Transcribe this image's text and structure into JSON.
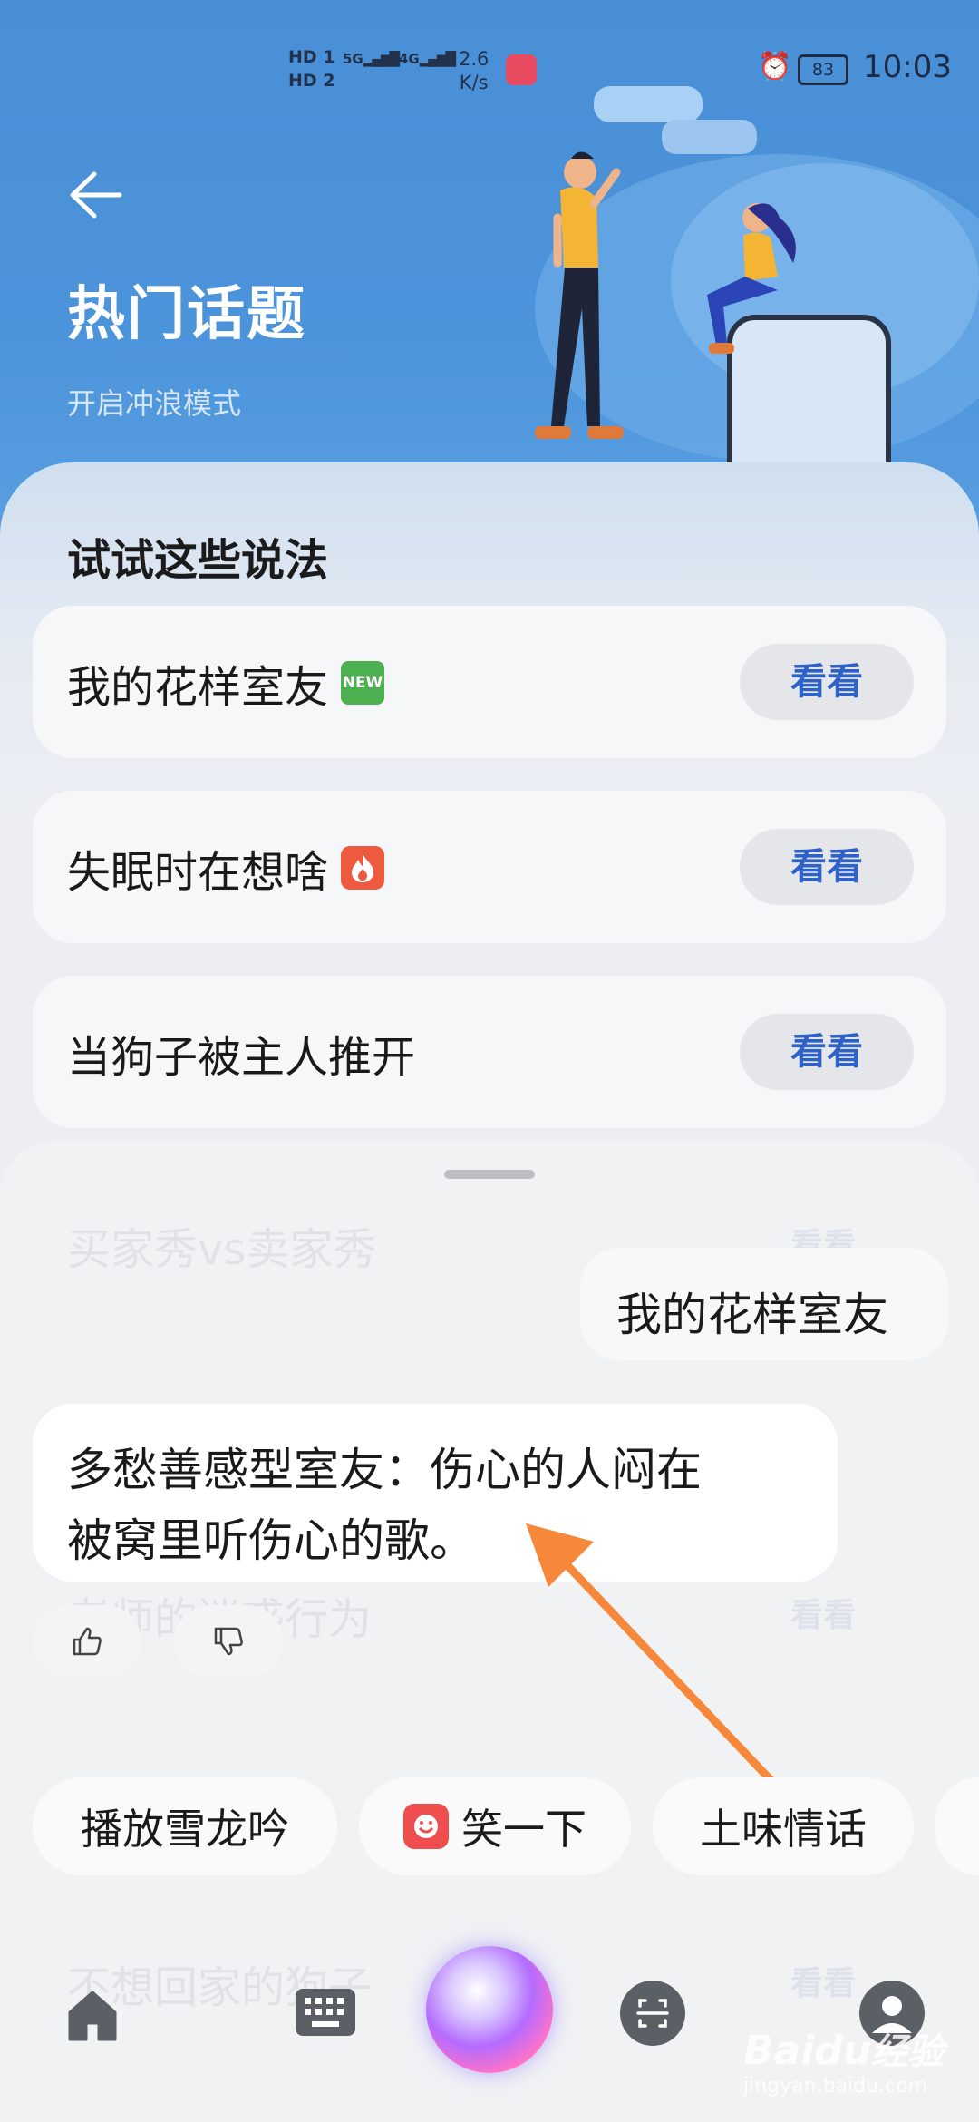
{
  "status_bar": {
    "hd1": "HD",
    "hd1_num": "1",
    "hd2": "HD",
    "hd2_num": "2",
    "sig1": "5G",
    "sig2": "4G",
    "speed_value": "2.6",
    "speed_unit": "K/s",
    "battery": "83",
    "time": "10:03"
  },
  "header": {
    "title": "热门话题",
    "subtitle": "开启冲浪模式"
  },
  "suggestions": {
    "title": "试试这些说法",
    "items": [
      {
        "label": "我的花样室友",
        "badge": "NEW",
        "button": "看看"
      },
      {
        "label": "失眠时在想啥",
        "badge": "fire-icon",
        "button": "看看"
      },
      {
        "label": "当狗子被主人推开",
        "button": "看看"
      }
    ]
  },
  "background_items": [
    {
      "label": "买家秀vs卖家秀",
      "button": "看看"
    },
    {
      "label": "老师的迷惑行为",
      "button": "看看"
    },
    {
      "label": "不想回家的狗子",
      "button": "看看"
    }
  ],
  "chat": {
    "user_message": "我的花样室友",
    "reply_line1": "多愁善感型室友：伤心的人闷在",
    "reply_line2": "被窝里听伤心的歌。"
  },
  "quick_chips": [
    {
      "label": "播放雪龙吟"
    },
    {
      "label": "笑一下",
      "icon": "laugh-app-icon"
    },
    {
      "label": "土味情话"
    }
  ],
  "bottom_nav": {
    "icons": [
      "home-icon",
      "keyboard-icon",
      "voice-orb-icon",
      "scan-icon",
      "profile-icon"
    ]
  },
  "watermark": {
    "brand": "Baidu",
    "brand_cn": "经验",
    "url": "jingyan.baidu.com"
  },
  "colors": {
    "header_blue": "#4a8fd6",
    "button_text_blue": "#2e62c8",
    "new_badge_green": "#4caf50",
    "fire_badge_red": "#ee5a3f",
    "annotation_arrow": "#f5883a"
  }
}
